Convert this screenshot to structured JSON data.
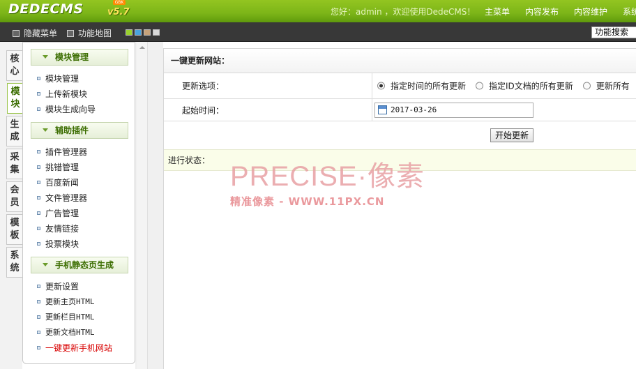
{
  "header": {
    "logo": "DEDECMS",
    "version": "v5.7",
    "badge": "GBK",
    "welcome": "您好：admin ，欢迎使用DedeCMS！",
    "nav": [
      "主菜单",
      "内容发布",
      "内容维护",
      "系统"
    ]
  },
  "toolbar": {
    "hide_menu": "隐藏菜单",
    "func_map": "功能地图",
    "select_value": "功能搜索",
    "swatch_colors": [
      "#9ad12e",
      "#4aa3de",
      "#c7a27a",
      "#d9d9d9"
    ]
  },
  "vtabs": [
    {
      "label": "核心",
      "active": false
    },
    {
      "label": "模块",
      "active": true
    },
    {
      "label": "生成",
      "active": false
    },
    {
      "label": "采集",
      "active": false
    },
    {
      "label": "会员",
      "active": false
    },
    {
      "label": "模板",
      "active": false
    },
    {
      "label": "系统",
      "active": false
    }
  ],
  "menu": {
    "groups": [
      {
        "title": "模块管理",
        "items": [
          "模块管理",
          "上传新模块",
          "模块生成向导"
        ]
      },
      {
        "title": "辅助插件",
        "items": [
          "插件管理器",
          "挑错管理",
          "百度新闻",
          "文件管理器",
          "广告管理",
          "友情链接",
          "投票模块"
        ]
      },
      {
        "title": "手机静态页生成",
        "items": [
          "更新设置",
          "更新主页HTML",
          "更新栏目HTML",
          "更新文档HTML",
          "一键更新手机网站"
        ]
      }
    ],
    "active_item": "一键更新手机网站"
  },
  "main": {
    "title": "一键更新网站：",
    "update_label": "更新选项：",
    "options": [
      "指定时间的所有更新",
      "指定ID文档的所有更新",
      "更新所有"
    ],
    "selected_option": 0,
    "start_label": "起始时间：",
    "start_value": "2017-03-26",
    "start_button": "开始更新",
    "status_label": "进行状态："
  },
  "watermark": {
    "main": "PRECISE·像素",
    "sub": "精准像素 - WWW.11PX.CN"
  },
  "colors": {
    "header_green": "#7cb518",
    "menu_head_text": "#3b6d00",
    "active_item": "#d80000",
    "status_bg": "#fafde9"
  }
}
